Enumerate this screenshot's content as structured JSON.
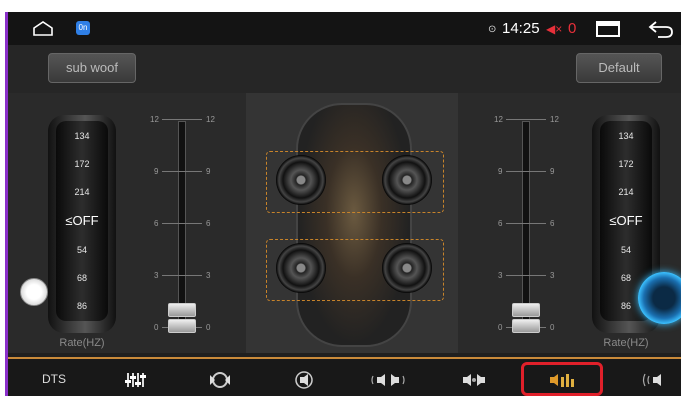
{
  "status": {
    "time": "14:25",
    "volume": "0",
    "app_badge": "0n"
  },
  "top": {
    "subwoof_label": "sub woof",
    "default_label": "Default"
  },
  "left_rate": {
    "items": [
      "134",
      "172",
      "214",
      "≤OFF",
      "54",
      "68",
      "86"
    ],
    "label": "Rate(HZ)"
  },
  "right_rate": {
    "items": [
      "134",
      "172",
      "214",
      "≤OFF",
      "54",
      "68",
      "86"
    ],
    "label": "Rate(HZ)"
  },
  "slider_ticks": [
    "12",
    "9",
    "6",
    "3",
    "0"
  ],
  "left_slider_level": 0,
  "right_slider_level": 0,
  "bottom": {
    "dts_label": "DTS"
  },
  "colors": {
    "accent": "#c98a3a",
    "highlight": "#e0202a",
    "frame": "#8a2fc9"
  }
}
